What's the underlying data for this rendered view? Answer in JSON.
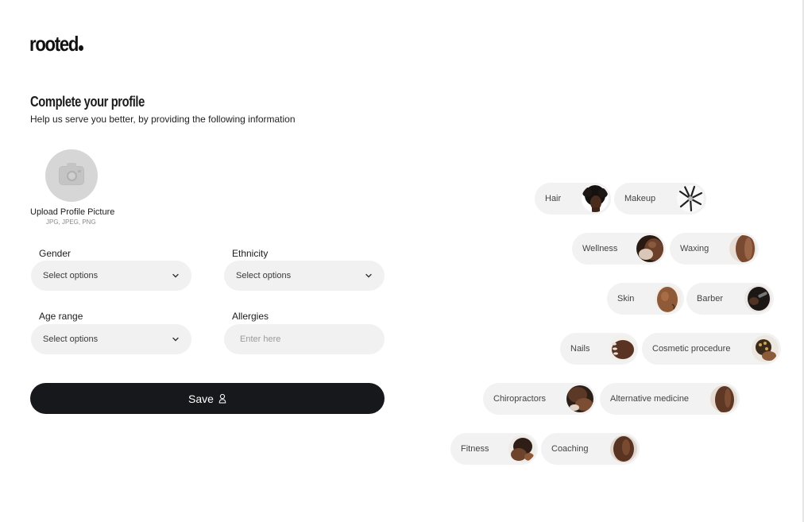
{
  "brand": {
    "logo_text": "rooted"
  },
  "header": {
    "title": "Complete your profile",
    "subtitle": "Help us serve you better, by providing the following information"
  },
  "upload": {
    "label": "Upload Profile Picture",
    "formats": "JPG, JPEG, PNG",
    "icon": "camera-icon"
  },
  "form": {
    "gender": {
      "label": "Gender",
      "value": "Select options"
    },
    "ethnicity": {
      "label": "Ethnicity",
      "value": "Select options"
    },
    "age_range": {
      "label": "Age range",
      "value": "Select options"
    },
    "allergies": {
      "label": "Allergies",
      "placeholder": "Enter here"
    }
  },
  "save_button": {
    "label": "Save",
    "icon": "person-icon"
  },
  "categories": [
    {
      "label": "Hair"
    },
    {
      "label": "Makeup"
    },
    {
      "label": "Wellness"
    },
    {
      "label": "Waxing"
    },
    {
      "label": "Skin"
    },
    {
      "label": "Barber"
    },
    {
      "label": "Nails"
    },
    {
      "label": "Cosmetic procedure"
    },
    {
      "label": "Chiropractors"
    },
    {
      "label": "Alternative medicine"
    },
    {
      "label": "Fitness"
    },
    {
      "label": "Coaching"
    }
  ],
  "colors": {
    "primary": "#17181b",
    "field_bg": "#f1f1f1",
    "chip_bg": "#f2f2f2",
    "avatar_bg": "#d6d6d6"
  }
}
